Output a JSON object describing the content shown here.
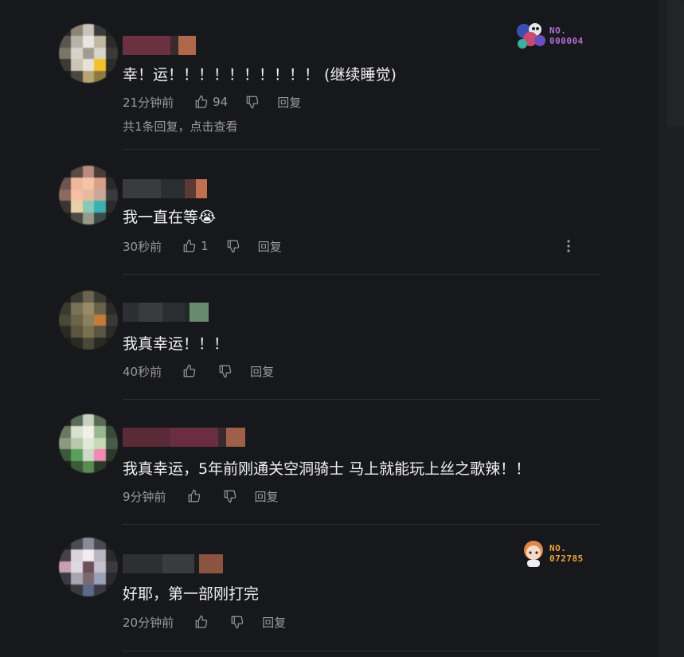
{
  "colors": {
    "background": "#17181b",
    "badge1": "#b36fd6",
    "badge2": "#f0a23c"
  },
  "comments": [
    {
      "text": "幸！运！！！！！！！！！！  (继续睡觉)",
      "time": "21分钟前",
      "likes": "94",
      "reply_label": "回复",
      "replies_link": "共1条回复，点击查看",
      "badge": {
        "no_label": "NO.",
        "number": "000004"
      }
    },
    {
      "text": "我一直在等😭",
      "time": "30秒前",
      "likes": "1",
      "reply_label": "回复"
    },
    {
      "text": "我真幸运！！！",
      "time": "40秒前",
      "likes": "",
      "reply_label": "回复"
    },
    {
      "text": "我真幸运，5年前刚通关空洞骑士 马上就能玩上丝之歌辣！！",
      "time": "9分钟前",
      "likes": "",
      "reply_label": "回复"
    },
    {
      "text": "好耶，第一部刚打完",
      "time": "20分钟前",
      "likes": "",
      "reply_label": "回复",
      "badge": {
        "no_label": "NO.",
        "number": "072785"
      }
    }
  ],
  "icons": [
    "thumbs-up-icon",
    "thumbs-down-icon",
    "more-icon"
  ]
}
